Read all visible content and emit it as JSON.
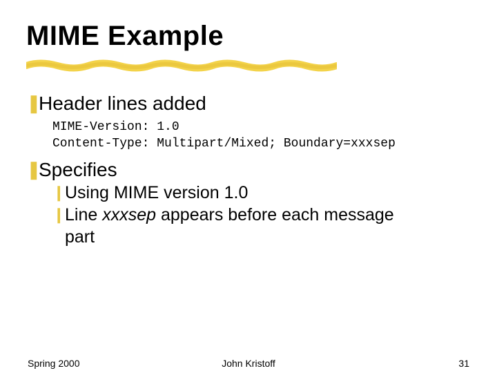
{
  "title": "MIME Example",
  "bullets": {
    "b1": {
      "label": "Header lines added"
    },
    "code": {
      "line1": "MIME-Version: 1.0",
      "line2": "Content-Type: Multipart/Mixed; Boundary=xxxsep"
    },
    "b2": {
      "label": "Specifies"
    },
    "sub": {
      "s1": "Using MIME version 1.0",
      "s2a": "Line ",
      "s2b": "xxxsep",
      "s2c": " appears before each message",
      "s2d": "part"
    }
  },
  "footer": {
    "left": "Spring 2000",
    "center": "John Kristoff",
    "right": "31"
  },
  "bullet_glyphs": {
    "l1": "❚",
    "l2": "❙"
  }
}
